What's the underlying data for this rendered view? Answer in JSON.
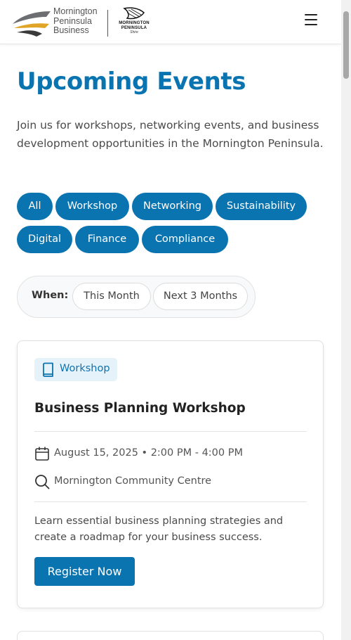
{
  "brand": {
    "logo_lines": [
      "Mornington",
      "Peninsula",
      "Business"
    ],
    "shire_lines": [
      "MORNINGTON",
      "PENINSULA"
    ],
    "shire_sub": "Shire",
    "accent_color": "#0a74b0",
    "logo_gold": "#e0a526",
    "logo_grey": "#6d6e71"
  },
  "header": {
    "menu_icon": "hamburger-menu-icon"
  },
  "page": {
    "title": "Upcoming Events",
    "intro": "Join us for workshops, networking events, and business development opportunities in the Mornington Peninsula."
  },
  "filters": {
    "categories": [
      "All",
      "Workshop",
      "Networking",
      "Sustainability",
      "Digital",
      "Finance",
      "Compliance"
    ],
    "when_label": "When:",
    "when_options": [
      "This Month",
      "Next 3 Months"
    ]
  },
  "events": [
    {
      "badge": "Workshop",
      "badge_icon": "book-icon",
      "title": "Business Planning Workshop",
      "datetime": "August 15, 2025 • 2:00 PM - 4:00 PM",
      "datetime_icon": "calendar-icon",
      "location": "Mornington Community Centre",
      "location_icon": "search-icon",
      "description": "Learn essential business planning strategies and create a roadmap for your business success.",
      "cta": "Register Now"
    }
  ]
}
